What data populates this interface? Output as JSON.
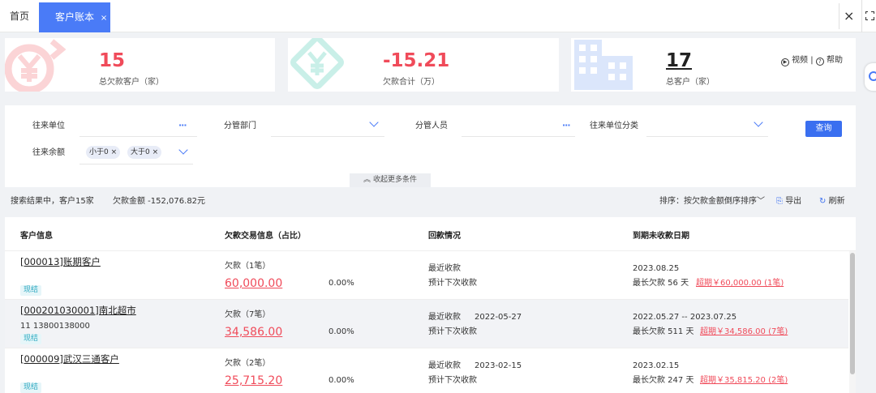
{
  "tabs": {
    "home": "首页",
    "active": "客户账本",
    "active_close": "×",
    "close_all": "×"
  },
  "summary": {
    "debt_customers": {
      "value": "15",
      "label": "总欠款客户（家）"
    },
    "debt_total": {
      "value": "-15.21",
      "label": "欠款合计（万）"
    },
    "total_customers": {
      "value": "17",
      "label": "总客户（家）"
    },
    "video": "视频",
    "divider": "|",
    "help": "帮助"
  },
  "filters": {
    "partner_label": "往来单位",
    "dept_label": "分管部门",
    "staff_label": "分管人员",
    "category_label": "往来单位分类",
    "balance_label": "往来余额",
    "tags": [
      "小于0",
      "大于0"
    ],
    "tag_close": "×",
    "dots": "···",
    "search_button": "查询",
    "collapse_label": "收起更多条件"
  },
  "result_bar": {
    "summary": "搜索结果中，客户15家",
    "amount": "欠款金额 -152,076.82元",
    "sort": "排序：按欠款金额倒序排序",
    "export": "导出",
    "refresh": "刷新"
  },
  "table": {
    "headers": [
      "客户信息",
      "欠款交易信息（占比）",
      "回款情况",
      "到期未收款日期"
    ],
    "rows": [
      {
        "customer": "[000013]账期客户",
        "phone": "",
        "status": "现结",
        "debt_label": "欠款（1笔）",
        "debt_amount": "60,000.00",
        "ratio": "0.00%",
        "recent_label": "最近收款",
        "recent_date": "",
        "next_label": "预计下次收款",
        "due_date": "2023.08.25",
        "max_days": "最长欠款 56 天",
        "overdue": "超期￥60,000.00 (1笔)"
      },
      {
        "customer": "[000201030001]南北超市",
        "phone": "11   13800138000",
        "status": "现结",
        "debt_label": "欠款（7笔）",
        "debt_amount": "34,586.00",
        "ratio": "0.00%",
        "recent_label": "最近收款",
        "recent_date": "2022-05-27",
        "next_label": "预计下次收款",
        "due_date": "2022.05.27 -- 2023.07.25",
        "max_days": "最长欠款 511 天",
        "overdue": "超期￥34,586.00 (7笔)"
      },
      {
        "customer": "[000009]武汉三通客户",
        "phone": "",
        "status": "现结",
        "debt_label": "欠款（2笔）",
        "debt_amount": "25,715.20",
        "ratio": "0.00%",
        "recent_label": "最近收款",
        "recent_date": "2023-02-15",
        "next_label": "预计下次收款",
        "due_date": "2023.02.15",
        "max_days": "最长欠款 247 天",
        "overdue": "超期￥35,815.20 (2笔)"
      }
    ]
  },
  "colors": {
    "accent": "#4a7bf7",
    "debt_red": "#f04b5a",
    "status_teal": "#2fa9c1"
  }
}
